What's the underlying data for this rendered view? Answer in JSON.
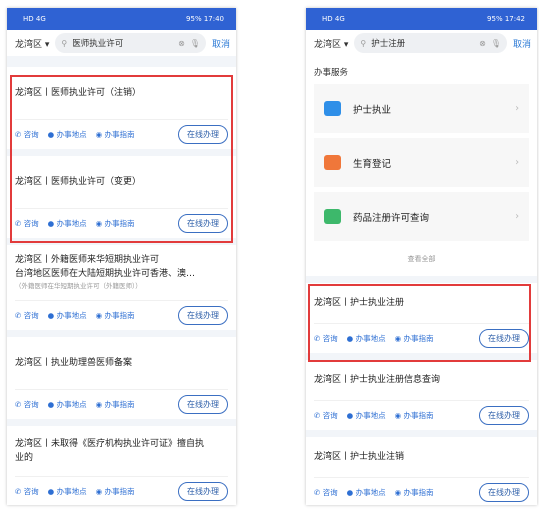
{
  "left": {
    "status": {
      "left": "HD 4G",
      "right": "95% 17:40"
    },
    "search": {
      "region": "龙湾区",
      "query": "医师执业许可",
      "cancel": "取消"
    },
    "cards": [
      {
        "title": "龙湾区丨医师执业许可（注销）"
      },
      {
        "title": "龙湾区丨医师执业许可（变更）"
      },
      {
        "title": "龙湾区丨外籍医师来华短期执业许可",
        "title2": "台湾地区医师在大陆短期执业许可香港、澳…",
        "sub": "（外籍医师在华短期执业许可（外籍医师））"
      },
      {
        "title": "龙湾区丨执业助理兽医师备案"
      },
      {
        "title": "龙湾区丨未取得《医疗机构执业许可证》擅自执",
        "title2": "业的"
      }
    ]
  },
  "actions": {
    "consult": "咨询",
    "location": "办事地点",
    "guide": "办事指南",
    "online": "在线办理"
  },
  "right": {
    "status": {
      "left": "HD 4G",
      "right": "95% 17:42"
    },
    "search": {
      "region": "龙湾区",
      "query": "护士注册",
      "cancel": "取消"
    },
    "section_title": "办事服务",
    "services": [
      {
        "label": "护士执业",
        "color": "#2f8fe8"
      },
      {
        "label": "生育登记",
        "color": "#f0773a"
      },
      {
        "label": "药品注册许可查询",
        "color": "#3db86b"
      }
    ],
    "view_all": "查看全部",
    "cards": [
      {
        "title": "龙湾区丨护士执业注册"
      },
      {
        "title": "龙湾区丨护士执业注册信息查询"
      },
      {
        "title": "龙湾区丨护士执业注销"
      }
    ]
  },
  "highlight_color": "#e23b3b"
}
